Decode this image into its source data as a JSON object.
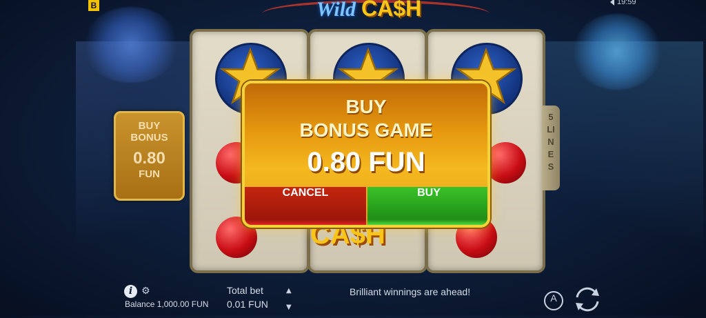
{
  "top": {
    "brand_badge": "B",
    "logo_word1": "Wild",
    "logo_word2": "CA$H",
    "status_time": "19:59"
  },
  "panel_left": {
    "title_line1": "BUY",
    "title_line2": "BONUS",
    "price": "0.80",
    "currency": "FUN"
  },
  "panel_right": {
    "lines_label": "5 LINES"
  },
  "modal": {
    "title_line1": "BUY",
    "title_line2": "BONUS GAME",
    "price": "0.80 FUN",
    "cancel_label": "CANCEL",
    "buy_label": "BUY"
  },
  "reels_bottom_logo": "CA$H",
  "bottom_bar": {
    "balance": "Balance 1,000.00 FUN",
    "total_bet_label": "Total bet",
    "total_bet_value": "0.01 FUN",
    "message": "Brilliant winnings are ahead!",
    "autoplay_label": "A"
  }
}
